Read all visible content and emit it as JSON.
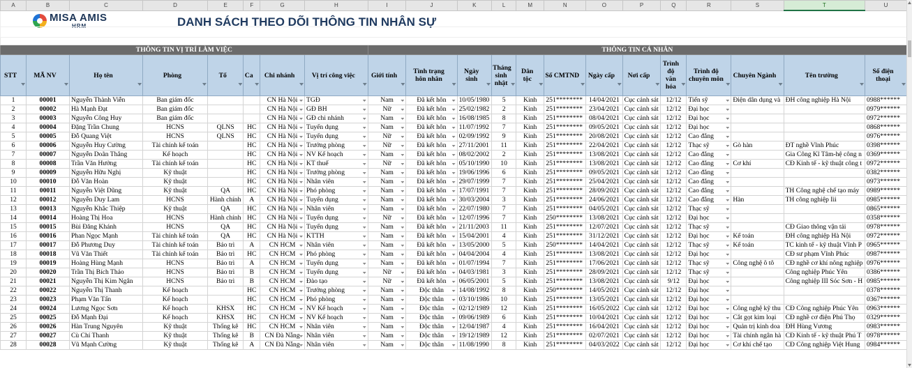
{
  "column_letters": [
    "A",
    "B",
    "C",
    "D",
    "E",
    "F",
    "G",
    "H",
    "I",
    "J",
    "K",
    "L",
    "M",
    "N",
    "O",
    "P",
    "Q",
    "R",
    "S",
    "T",
    "U"
  ],
  "selected_column": "T",
  "logo": {
    "line1": "MISA AMIS",
    "line2": "HRM"
  },
  "title": "DANH SÁCH THEO DÕI THÔNG TIN NHÂN SỰ",
  "section_work": "THÔNG TIN VỊ TRÍ LÀM VIỆC",
  "section_personal": "THÔNG TIN CÁ NHÂN",
  "headers": [
    "STT",
    "MÃ NV",
    "Họ tên",
    "Phòng",
    "Tổ",
    "Ca",
    "Chi nhánh",
    "Vị trí công việc",
    "Giới tính",
    "Tình trạng hôn nhân",
    "Ngày sinh",
    "Tháng sinh nhật",
    "Dân tộc",
    "Số CMTND",
    "Ngày cấp",
    "Nơi cấp",
    "Trình độ văn hóa",
    "Trình độ chuyên môn",
    "Chuyên Ngành",
    "Tên trường",
    "Số điện thoại"
  ],
  "rows": [
    [
      "1",
      "00001",
      "Nguyễn Thành Viễn",
      "Ban giám đốc",
      "",
      "",
      "CN Hà Nội",
      "TGĐ",
      "Nam",
      "Đã kết hôn",
      "10/05/1980",
      "5",
      "Kinh",
      "251********",
      "14/04/2021",
      "Cục cảnh sát",
      "12/12",
      "Tiến sỹ",
      "Điện dân dụng và",
      "ĐH công nghiệp Hà Nội",
      "0988******"
    ],
    [
      "2",
      "00002",
      "Hà Mạnh Đạt",
      "Ban giám đốc",
      "",
      "",
      "CN Hà Nội",
      "GĐ BH",
      "Nữ",
      "Đã kết hôn",
      "25/02/1982",
      "2",
      "Kinh",
      "251********",
      "23/04/2021",
      "Cục cảnh sát",
      "12/12",
      "Đại học",
      "",
      "",
      "0979******"
    ],
    [
      "3",
      "00003",
      "Nguyễn Công Huy",
      "Ban giám đốc",
      "",
      "",
      "CN Hà Nội",
      "GĐ chi nhánh",
      "Nam",
      "Đã kết hôn",
      "16/08/1985",
      "8",
      "Kinh",
      "251********",
      "08/04/2021",
      "Cục cảnh sát",
      "12/12",
      "Đại học",
      "",
      "",
      "0972******"
    ],
    [
      "4",
      "00004",
      "Đặng Trần Chung",
      "HCNS",
      "QLNS",
      "HC",
      "CN Hà Nội",
      "Tuyển dụng",
      "Nam",
      "Đã kết hôn",
      "11/07/1992",
      "7",
      "Kinh",
      "251********",
      "09/05/2021",
      "Cục cảnh sát",
      "12/12",
      "Đại học",
      "",
      "",
      "0868******"
    ],
    [
      "5",
      "00005",
      "Đỗ Quang Việt",
      "HCNS",
      "QLNS",
      "HC",
      "CN Hà Nội",
      "Tuyển dụng",
      "Nữ",
      "Đã kết hôn",
      "02/09/1992",
      "9",
      "Kinh",
      "251********",
      "20/08/2021",
      "Cục cảnh sát",
      "12/12",
      "Cao đẳng",
      "",
      "",
      "0976******"
    ],
    [
      "6",
      "00006",
      "Nguyễn Huy Cường",
      "Tài chính kế toán",
      "",
      "HC",
      "CN Hà Nội",
      "Trưởng phòng",
      "Nữ",
      "Đã kết hôn",
      "27/11/2001",
      "11",
      "Kinh",
      "251********",
      "22/04/2021",
      "Cục cảnh sát",
      "12/12",
      "Thạc sỹ",
      "Gò hàn",
      "ĐT nghề Vĩnh Phúc",
      "0398******"
    ],
    [
      "7",
      "00007",
      "Nguyễn Doãn Thắng",
      "Kế hoạch",
      "",
      "HC",
      "CN Hà Nội",
      "NV Kế hoạch",
      "Nam",
      "Đã kết hôn",
      "08/02/2002",
      "2",
      "Kinh",
      "251********",
      "13/08/2021",
      "Cục cảnh sát",
      "12/12",
      "Cao đẳng",
      "",
      "Gia Công Kĩ Tâm-hệ công n",
      "0369******"
    ],
    [
      "8",
      "00008",
      "Trần Văn Hưởng",
      "Tài chính kế toán",
      "",
      "HC",
      "CN Hà Nội",
      "KT thuế",
      "Nữ",
      "Đã kết hôn",
      "05/10/1990",
      "10",
      "Kinh",
      "251********",
      "13/08/2021",
      "Cục cảnh sát",
      "12/12",
      "Cao đẳng",
      "Cơ khí",
      "CĐ Kinh tế - kỹ thuật công t",
      "0972******"
    ],
    [
      "9",
      "00009",
      "Nguyễn Hữu Nghị",
      "Kỹ thuật",
      "",
      "HC",
      "CN Hà Nội",
      "Trưởng phòng",
      "Nam",
      "Đã kết hôn",
      "19/06/1996",
      "6",
      "Kinh",
      "251********",
      "09/05/2021",
      "Cục cảnh sát",
      "12/12",
      "Cao đẳng",
      "",
      "",
      "0382******"
    ],
    [
      "10",
      "00010",
      "Đỗ Văn Hoàn",
      "Kỹ thuật",
      "",
      "HC",
      "CN Hà Nội",
      "Nhân viên",
      "Nam",
      "Đã kết hôn",
      "29/07/1999",
      "7",
      "Kinh",
      "251********",
      "25/04/2021",
      "Cục cảnh sát",
      "12/12",
      "Cao đẳng",
      "",
      "",
      "0973******"
    ],
    [
      "11",
      "00011",
      "Nguyễn Việt Dũng",
      "Kỹ thuật",
      "QA",
      "HC",
      "CN Hà Nội",
      "Phó phòng",
      "Nam",
      "Đã kết hôn",
      "17/07/1991",
      "7",
      "Kinh",
      "251********",
      "28/09/2021",
      "Cục cảnh sát",
      "12/12",
      "Cao đẳng",
      "",
      "TH Công nghệ chế tạo máy",
      "0989******"
    ],
    [
      "12",
      "00012",
      "Nguyễn Duy Lam",
      "HCNS",
      "Hành chính",
      "A",
      "CN Hà Nội",
      "Tuyển dụng",
      "Nam",
      "Đã kết hôn",
      "30/03/2004",
      "3",
      "Kinh",
      "251********",
      "24/06/2021",
      "Cục cảnh sát",
      "12/12",
      "Cao đẳng",
      "Hàn",
      "TH công nghiệp Iii",
      "0985******"
    ],
    [
      "13",
      "00013",
      "Nguyễn Khắc Thiệp",
      "Kỹ thuật",
      "QA",
      "HC",
      "CN Hà Nội",
      "Nhân viên",
      "Nam",
      "Đã kết hôn",
      "22/07/1980",
      "7",
      "Kinh",
      "251********",
      "04/05/2021",
      "Cục cảnh sát",
      "12/12",
      "Thạc sỹ",
      "",
      "",
      "0865******"
    ],
    [
      "14",
      "00014",
      "Hoàng Thị Hoa",
      "HCNS",
      "Hành chính",
      "HC",
      "CN Hà Nội",
      "Tuyển dụng",
      "Nữ",
      "Đã kết hôn",
      "12/07/1996",
      "7",
      "Kinh",
      "250********",
      "13/08/2021",
      "Cục cảnh sát",
      "12/12",
      "Đại học",
      "",
      "",
      "0358******"
    ],
    [
      "15",
      "00015",
      "Bùi Đăng Khánh",
      "HCNS",
      "QA",
      "HC",
      "CN Hà Nội",
      "Tuyển dụng",
      "Nam",
      "Đã kết hôn",
      "21/11/2003",
      "11",
      "Kinh",
      "251********",
      "12/07/2021",
      "Cục cảnh sát",
      "12/12",
      "Thạc sỹ",
      "",
      "CĐ Giao thông vận tải",
      "0978******"
    ],
    [
      "16",
      "00016",
      "Phan Ngọc Mạnh",
      "Tài chính kế toán",
      "QA",
      "HC",
      "CN Hà Nội",
      "KTTH",
      "Nam",
      "Đã kết hôn",
      "15/04/2001",
      "4",
      "Kinh",
      "251********",
      "31/12/2021",
      "Cục cảnh sát",
      "12/12",
      "Đại học",
      "Kế toán",
      "ĐH công nghiệp Hà Nội",
      "0972******"
    ],
    [
      "17",
      "00017",
      "Đỗ Phương Duy",
      "Tài chính kế toán",
      "Bảo trì",
      "A",
      "CN HCM",
      "Nhân viên",
      "Nam",
      "Đã kết hôn",
      "13/05/2000",
      "5",
      "Kinh",
      "250********",
      "14/04/2021",
      "Cục cảnh sát",
      "12/12",
      "Thạc sỹ",
      "Kế toán",
      "TC kinh tế - kỹ thuật Vĩnh P",
      "0965******"
    ],
    [
      "18",
      "00018",
      "Vũ Văn Thiết",
      "Tài chính kế toán",
      "Bảo trì",
      "HC",
      "CN HCM",
      "Phó phòng",
      "Nam",
      "Đã kết hôn",
      "04/04/2004",
      "4",
      "Kinh",
      "251********",
      "13/08/2021",
      "Cục cảnh sát",
      "12/12",
      "Đại học",
      "",
      "CĐ sư phạm Vĩnh Phúc",
      "0987******"
    ],
    [
      "19",
      "00019",
      "Hoàng Hùng Mạnh",
      "HCNS",
      "Bảo trì",
      "A",
      "CN HCM",
      "Tuyển dụng",
      "Nam",
      "Đã kết hôn",
      "01/07/1994",
      "7",
      "Kinh",
      "251********",
      "17/06/2021",
      "Cục cảnh sát",
      "12/12",
      "Thạc sỹ",
      "Công nghệ ô tô",
      "CĐ nghề cơ khí nông nghiệp",
      "0976******"
    ],
    [
      "20",
      "00020",
      "Trần Thị Bích Thảo",
      "HCNS",
      "Bảo trì",
      "B",
      "CN HCM",
      "Tuyển dụng",
      "Nữ",
      "Đã kết hôn",
      "04/03/1981",
      "3",
      "Kinh",
      "251********",
      "28/09/2021",
      "Cục cảnh sát",
      "12/12",
      "Thạc sỹ",
      "",
      "Công nghiệp Phúc Yên",
      "0386******"
    ],
    [
      "21",
      "00021",
      "Nguyễn Thị Kim Ngân",
      "HCNS",
      "Bảo trì",
      "B",
      "CN HCM",
      "Đào tạo",
      "Nữ",
      "Đã kết hôn",
      "06/05/2001",
      "5",
      "Kinh",
      "251********",
      "13/08/2021",
      "Cục cảnh sát",
      "9/12",
      "Đại học",
      "",
      "Công nghiệp III Sóc Sơn - H",
      "0985******"
    ],
    [
      "22",
      "00022",
      "Nguyễn Thị Thanh",
      "Kế hoạch",
      "",
      "HC",
      "CN HCM",
      "Trưởng phòng",
      "Nam",
      "Độc thân",
      "14/08/1992",
      "8",
      "Kinh",
      "250********",
      "14/05/2021",
      "Cục cảnh sát",
      "12/12",
      "Đại học",
      "",
      "",
      "0378******"
    ],
    [
      "23",
      "00023",
      "Phạm Văn Tấn",
      "Kế hoạch",
      "",
      "HC",
      "CN HCM",
      "Phó phòng",
      "Nam",
      "Độc thân",
      "03/10/1986",
      "10",
      "Kinh",
      "251********",
      "13/05/2021",
      "Cục cảnh sát",
      "12/12",
      "Đại học",
      "",
      "",
      "0367******"
    ],
    [
      "24",
      "00024",
      "Lương Ngọc Sơn",
      "Kế hoạch",
      "KHSX",
      "HC",
      "CN HCM",
      "NV Kế hoạch",
      "Nam",
      "Độc thân",
      "02/12/1989",
      "12",
      "Kinh",
      "251********",
      "16/05/2022",
      "Cục cảnh sát",
      "12/12",
      "Đại học",
      "Công nghệ kỹ thu",
      "CĐ Công nghiệp Phúc Yên",
      "0963******"
    ],
    [
      "25",
      "00025",
      "Đỗ Mạnh Đại",
      "Kế hoạch",
      "KHSX",
      "HC",
      "CN HCM",
      "NV Kế hoạch",
      "Nam",
      "Độc thân",
      "09/06/1989",
      "6",
      "Kinh",
      "251********",
      "10/04/2021",
      "Cục cảnh sát",
      "12/12",
      "Đại học",
      "Cắt gọt kim loại",
      "CĐ nghề cơ điện Phú Thọ",
      "0329******"
    ],
    [
      "26",
      "00026",
      "Hàn Trung Nguyên",
      "Kỹ thuật",
      "Thống kê",
      "HC",
      "CN HCM",
      "Nhân viên",
      "Nam",
      "Độc thân",
      "12/04/1987",
      "4",
      "Kinh",
      "251********",
      "16/04/2021",
      "Cục cảnh sát",
      "12/12",
      "Đại học",
      "Quản trị kinh doa",
      "ĐH Hùng Vương",
      "0983******"
    ],
    [
      "27",
      "00027",
      "Cù Chí Thanh",
      "Kỹ thuật",
      "Thống kê",
      "B",
      "CN Đà Nẵng",
      "Nhân viên",
      "Nam",
      "Độc thân",
      "19/12/1989",
      "12",
      "Kinh",
      "251********",
      "02/07/2021",
      "Cục cảnh sát",
      "12/12",
      "Đại học",
      "Tài chính ngân hà",
      "CĐ Kinh tế - kỹ thuật Phú T",
      "0978******"
    ],
    [
      "28",
      "00028",
      "Vũ Mạnh Cường",
      "Kỹ thuật",
      "Thống kê",
      "A",
      "CN Đà Nẵng",
      "Nhân viên",
      "Nam",
      "Độc thân",
      "11/08/1990",
      "8",
      "Kinh",
      "251********",
      "04/03/2022",
      "Cục cảnh sát",
      "12/12",
      "Đại học",
      "Cơ khí chế tạo",
      "CĐ Công nghiệp Việt Hung",
      "0984******"
    ]
  ]
}
